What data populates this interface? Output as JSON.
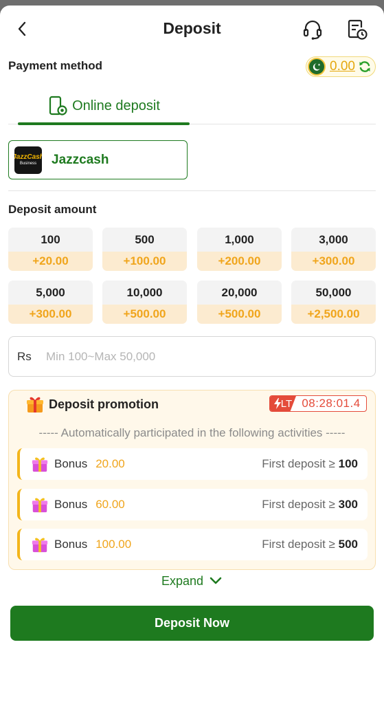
{
  "header": {
    "title": "Deposit",
    "back_icon": "chevron-left-icon",
    "support_icon": "headset-icon",
    "history_icon": "document-clock-icon"
  },
  "payment_method": {
    "label": "Payment method",
    "balance": "0.00",
    "flag_icon": "pakistan-flag-icon",
    "refresh_icon": "refresh-icon",
    "tab_label": "Online deposit",
    "tab_icon": "phone-deposit-icon",
    "method_name": "Jazzcash",
    "logo_text": "JazzCash",
    "logo_subtext": "Business"
  },
  "deposit_amount": {
    "label": "Deposit amount",
    "options": [
      {
        "amount": "100",
        "bonus": "+20.00"
      },
      {
        "amount": "500",
        "bonus": "+100.00"
      },
      {
        "amount": "1,000",
        "bonus": "+200.00"
      },
      {
        "amount": "3,000",
        "bonus": "+300.00"
      },
      {
        "amount": "5,000",
        "bonus": "+300.00"
      },
      {
        "amount": "10,000",
        "bonus": "+500.00"
      },
      {
        "amount": "20,000",
        "bonus": "+500.00"
      },
      {
        "amount": "50,000",
        "bonus": "+2,500.00"
      }
    ],
    "currency": "Rs",
    "placeholder": "Min 100~Max 50,000"
  },
  "promotion": {
    "title": "Deposit promotion",
    "lt_tag": "LT",
    "timer": "08:28:01.4",
    "subtitle": "----- Automatically participated in the following activities -----",
    "bonuses": [
      {
        "label": "Bonus",
        "value": "20.00",
        "condition": "First deposit ≥",
        "threshold": "100"
      },
      {
        "label": "Bonus",
        "value": "60.00",
        "condition": "First deposit ≥",
        "threshold": "300"
      },
      {
        "label": "Bonus",
        "value": "100.00",
        "condition": "First deposit ≥",
        "threshold": "500"
      }
    ],
    "expand_label": "Expand"
  },
  "deposit_button": "Deposit Now",
  "colors": {
    "primary_green": "#1e7a1f",
    "bonus_orange": "#f0a51c",
    "timer_red": "#e44b3a"
  }
}
